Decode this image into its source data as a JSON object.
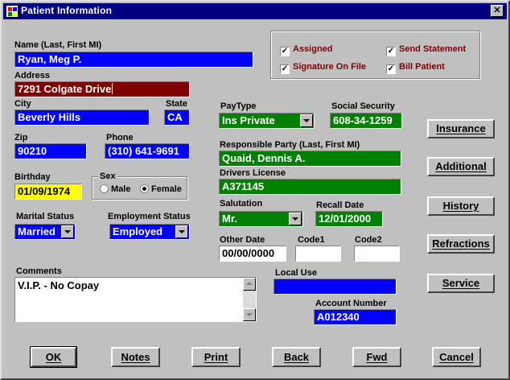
{
  "window": {
    "title": "Patient Information",
    "close_glyph": "✕"
  },
  "labels": {
    "name": "Name (Last, First MI)",
    "address": "Address",
    "city": "City",
    "state": "State",
    "zip": "Zip",
    "phone": "Phone",
    "birthday": "Birthday",
    "sex": "Sex",
    "marital": "Marital Status",
    "employment": "Employment Status",
    "comments": "Comments",
    "paytype": "PayType",
    "ssn": "Social Security",
    "responsible": "Responsible Party (Last, First MI)",
    "license": "Drivers License",
    "salutation": "Salutation",
    "recall": "Recall Date",
    "other_date": "Other Date",
    "code1": "Code1",
    "code2": "Code2",
    "local_use": "Local Use",
    "account": "Account Number"
  },
  "values": {
    "name": "Ryan, Meg P.",
    "address": "7291 Colgate Drive",
    "city": "Beverly Hills",
    "state": "CA",
    "zip": "90210",
    "phone": "(310) 641-9691",
    "birthday": "01/09/1974",
    "marital": "Married",
    "employment": "Employed",
    "comments": "V.I.P. - No Copay",
    "paytype": "Ins Private",
    "ssn": "608-34-1259",
    "responsible": "Quaid, Dennis A.",
    "license": "A371145",
    "salutation": "Mr.",
    "recall": "12/01/2000",
    "other_date": "00/00/0000",
    "code1": "",
    "code2": "",
    "local_use": "",
    "account": "A012340"
  },
  "sex_options": {
    "male": "Male",
    "female": "Female",
    "selected": "Female"
  },
  "checkboxes": {
    "assigned": "Assigned",
    "send_statement": "Send Statement",
    "signature_on_file": "Signature On File",
    "bill_patient": "Bill Patient",
    "check_glyph": "✓"
  },
  "side_buttons": {
    "insurance": "Insurance",
    "additional": "Additional",
    "history": "History",
    "refractions": "Refractions",
    "service": "Service"
  },
  "bottom_buttons": {
    "ok": "OK",
    "notes": "Notes",
    "print": "Print",
    "back": "Back",
    "fwd": "Fwd",
    "cancel": "Cancel"
  },
  "colors": {
    "title_bar": "#000080",
    "field_blue": "#0000ff",
    "field_green": "#008000",
    "field_maroon": "#800000",
    "field_yellow": "#ffff00",
    "checkbox_label": "#800000"
  }
}
